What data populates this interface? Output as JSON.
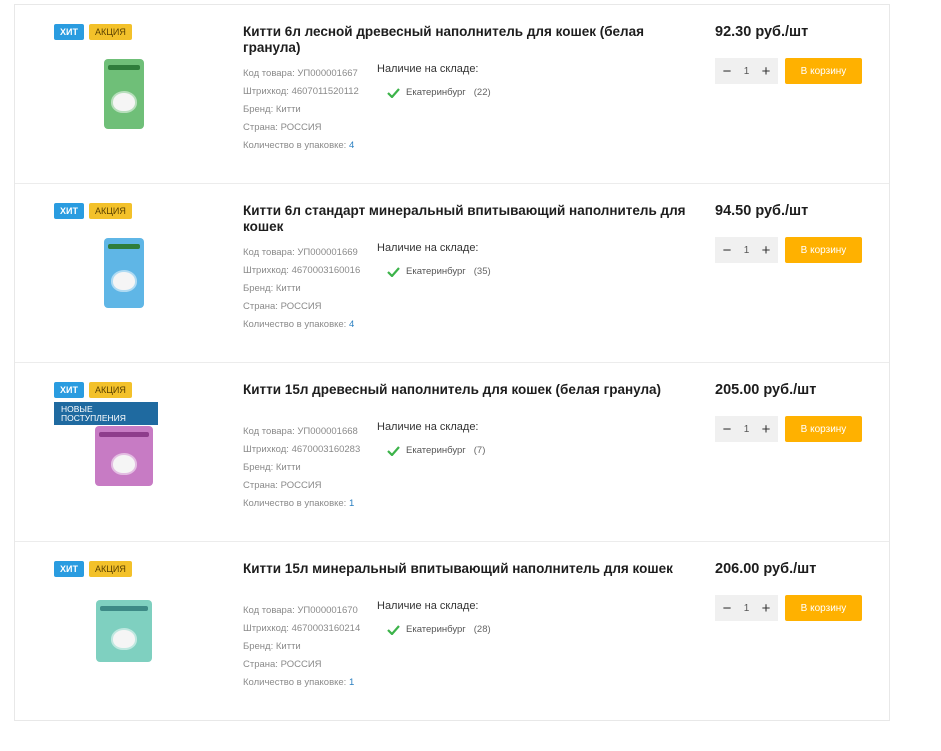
{
  "labels": {
    "code": "Код товара:",
    "barcode": "Штрихкод:",
    "brand": "Бренд:",
    "country": "Страна:",
    "pack": "Количество в упаковке:",
    "stock": "Наличие на складе:",
    "cart": "В корзину",
    "badge_hit": "хит",
    "badge_sale": "акция",
    "badge_new": "новые поступления"
  },
  "products": [
    {
      "title": "Китти 6л лесной древесный наполнитель для кошек (белая гранула)",
      "code": "УП000001667",
      "barcode": "4607011520112",
      "brand": "Китти",
      "country": "РОССИЯ",
      "pack": "4",
      "city": "Екатеринбург",
      "count": "(22)",
      "price": "92.30 руб./шт",
      "qty": "1",
      "bag_color": "#6fbf78"
    },
    {
      "title": "Китти 6л стандарт минеральный впитывающий наполнитель для кошек",
      "code": "УП000001669",
      "barcode": "4670003160016",
      "brand": "Китти",
      "country": "РОССИЯ",
      "pack": "4",
      "city": "Екатеринбург",
      "count": "(35)",
      "price": "94.50 руб./шт",
      "qty": "1",
      "bag_color": "#5fb6e6"
    },
    {
      "title": "Китти 15л древесный наполнитель для кошек (белая гранула)",
      "code": "УП000001668",
      "barcode": "4670003160283",
      "brand": "Китти",
      "country": "РОССИЯ",
      "pack": "1",
      "city": "Екатеринбург",
      "count": "(7)",
      "price": "205.00 руб./шт",
      "qty": "1",
      "bag_color": "#c77bc4"
    },
    {
      "title": "Китти 15л минеральный впитывающий наполнитель для кошек",
      "code": "УП000001670",
      "barcode": "4670003160214",
      "brand": "Китти",
      "country": "РОССИЯ",
      "pack": "1",
      "city": "Екатеринбург",
      "count": "(28)",
      "price": "206.00 руб./шт",
      "qty": "1",
      "bag_color": "#7fd0c0"
    }
  ]
}
